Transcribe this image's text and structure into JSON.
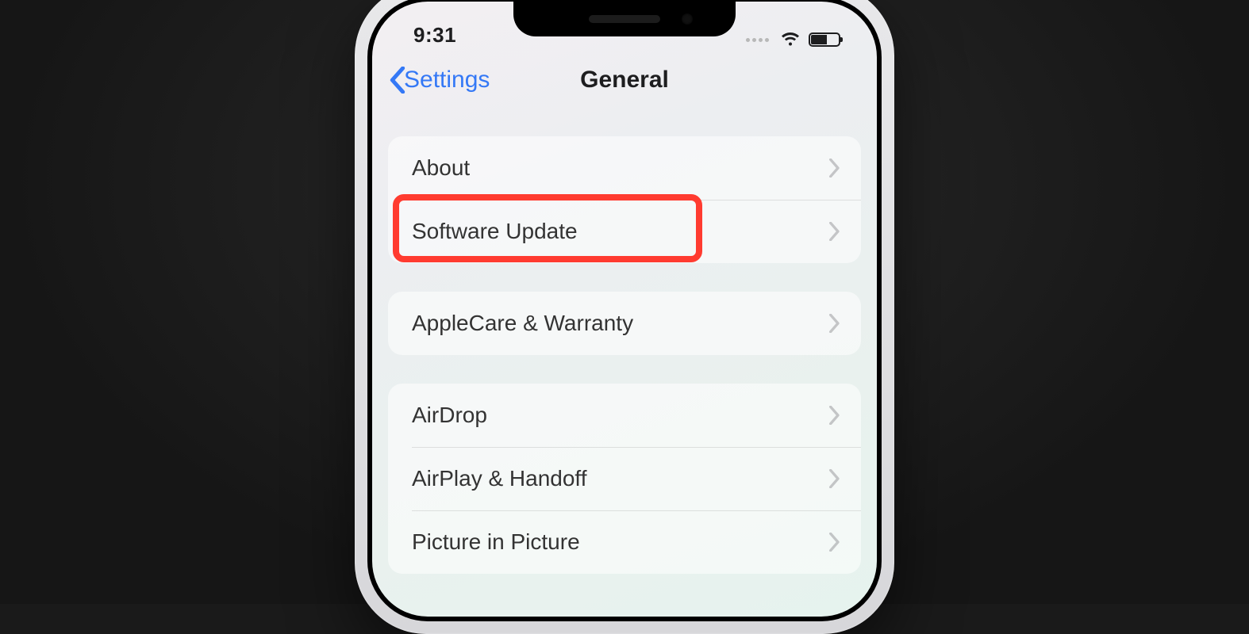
{
  "status": {
    "time": "9:31",
    "wifi": true,
    "battery_pct": 55
  },
  "nav": {
    "back_label": "Settings",
    "title": "General"
  },
  "groups": [
    {
      "rows": [
        {
          "label": "About"
        },
        {
          "label": "Software Update",
          "highlighted": true
        }
      ]
    },
    {
      "rows": [
        {
          "label": "AppleCare & Warranty"
        }
      ]
    },
    {
      "rows": [
        {
          "label": "AirDrop"
        },
        {
          "label": "AirPlay & Handoff"
        },
        {
          "label": "Picture in Picture"
        }
      ]
    }
  ],
  "annotation": {
    "highlight_color": "#ff3b30"
  }
}
